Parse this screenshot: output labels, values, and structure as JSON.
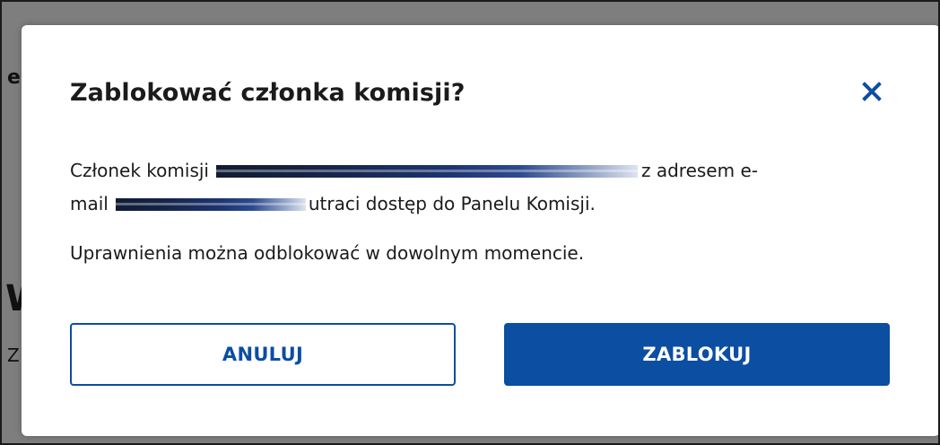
{
  "background": {
    "fragments": [
      "e",
      "W",
      "Z"
    ]
  },
  "modal": {
    "title": "Zablokować członka komisji?",
    "close_icon": "close-icon",
    "message": {
      "line1_prefix": "Członek komisji",
      "line1_suffix": "z adresem e-",
      "line2_prefix": "mail",
      "line2_suffix": "utraci dostęp do Panelu Komisji.",
      "paragraph2": "Uprawnienia można odblokować w dowolnym momencie."
    },
    "buttons": {
      "cancel_label": "ANULUJ",
      "block_label": "ZABLOKUJ"
    }
  },
  "colors": {
    "primary": "#0b4ea2",
    "overlay": "#7e7e7e",
    "text": "#1b1b1b"
  }
}
